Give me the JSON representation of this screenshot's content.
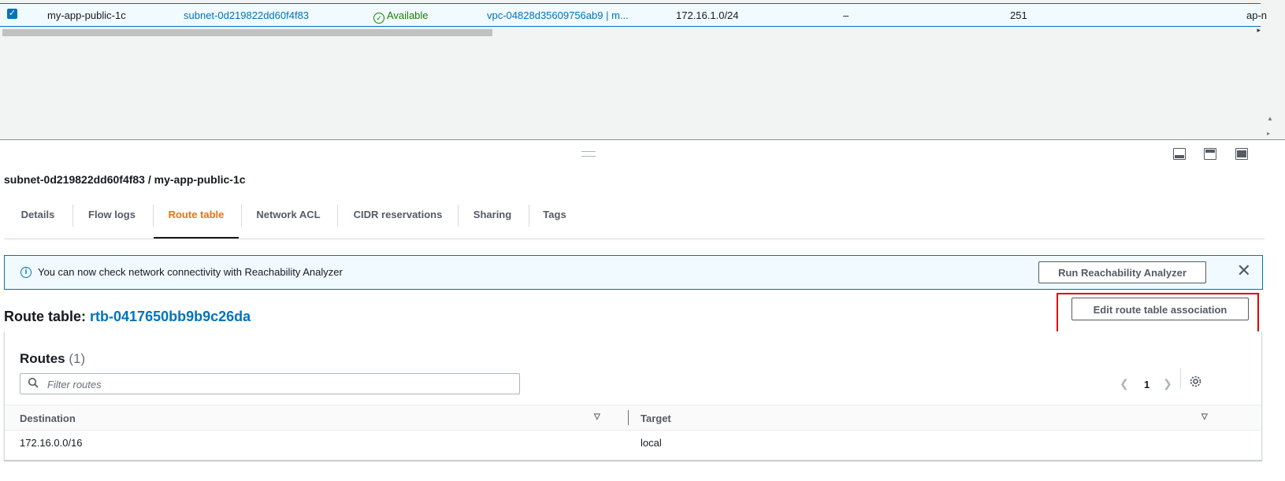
{
  "subnet_row": {
    "name": "my-app-public-1c",
    "subnet_id": "subnet-0d219822dd60f4f83",
    "state": "Available",
    "vpc": "vpc-04828d35609756ab9 | m...",
    "ipv4_cidr": "172.16.1.0/24",
    "ipv6_cidr": "–",
    "available_ips": "251",
    "az": "ap-n"
  },
  "detail": {
    "title": "subnet-0d219822dd60f4f83 / my-app-public-1c",
    "tabs": [
      "Details",
      "Flow logs",
      "Route table",
      "Network ACL",
      "CIDR reservations",
      "Sharing",
      "Tags"
    ],
    "active_tab": "Route table"
  },
  "banner": {
    "text": "You can now check network connectivity with Reachability Analyzer",
    "button": "Run Reachability Analyzer"
  },
  "route_table": {
    "label": "Route table:",
    "id": "rtb-0417650bb9b9c26da",
    "edit_button": "Edit route table association"
  },
  "routes": {
    "title": "Routes",
    "count": "(1)",
    "filter_placeholder": "Filter routes",
    "page": "1",
    "columns": [
      "Destination",
      "Target"
    ],
    "rows": [
      {
        "destination": "172.16.0.0/16",
        "target": "local"
      }
    ]
  },
  "icons": {
    "checkbox": "checkbox-checked-icon",
    "status": "check-circle-icon",
    "info": "info-icon",
    "close": "close-icon",
    "search": "search-icon",
    "settings": "gear-icon"
  },
  "colors": {
    "link": "#0073bb",
    "active_tab": "#ec7211",
    "available": "#1d8102",
    "highlight": "#e00000"
  }
}
